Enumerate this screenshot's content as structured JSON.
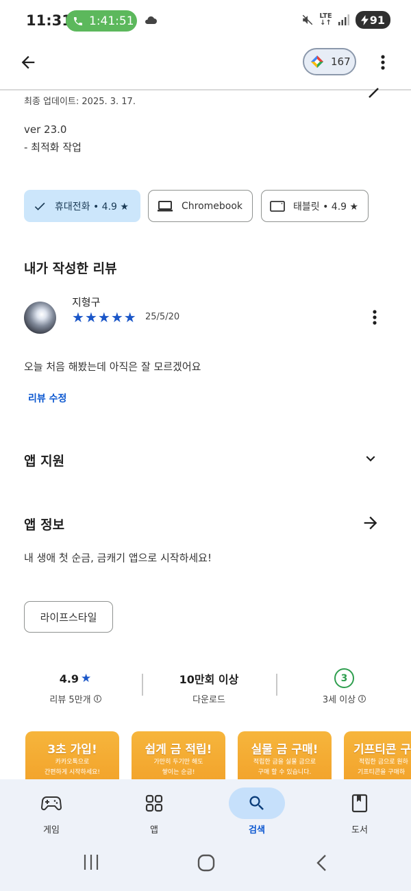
{
  "status_bar": {
    "time": "11:31",
    "call_timer": "1:41:51",
    "network": "LTE",
    "battery": "91"
  },
  "app_bar": {
    "back_icon": "arrow-back-icon",
    "points_value": "167",
    "more_icon": "more-vert-icon"
  },
  "whats_new": {
    "updated": "최종 업데이트: 2025. 3. 17.",
    "version": "ver 23.0",
    "note": "- 최적화 작업"
  },
  "device_chips": [
    {
      "label": "휴대전화 • 4.9",
      "icon": "check-icon",
      "selected": true,
      "has_star": true
    },
    {
      "label": "Chromebook",
      "icon": "laptop-icon",
      "selected": false,
      "has_star": false
    },
    {
      "label": "태블릿 • 4.9",
      "icon": "tablet-icon",
      "selected": false,
      "has_star": true
    }
  ],
  "my_review": {
    "title": "내가 작성한 리뷰",
    "reviewer": "지형구",
    "rating": 5,
    "date": "25/5/20",
    "text": "오늘 처음 해봤는데 아직은 잘 모르겠어요",
    "edit_label": "리뷰 수정"
  },
  "app_support": {
    "title": "앱 지원"
  },
  "app_info": {
    "title": "앱 정보",
    "description": "내 생애 첫 순금, 금캐기 앱으로 시작하세요!",
    "tag": "라이프스타일"
  },
  "stats": {
    "rating": "4.9",
    "reviews": "리뷰 5만개",
    "downloads": "10만회 이상",
    "downloads_label": "다운로드",
    "age": "3",
    "age_label": "3세 이상"
  },
  "screenshots": [
    {
      "title": "3초 가입!",
      "sub1": "카카오톡으로",
      "sub2": "간편하게 시작하세요!"
    },
    {
      "title": "쉽게 금 적립!",
      "sub1": "가만히 두기만 해도",
      "sub2": "쌓이는 순금!"
    },
    {
      "title": "실물 금 구매!",
      "sub1": "적립한 금을 실물 금으로",
      "sub2": "구매 할 수 있습니다."
    },
    {
      "title": "기프티콘 구",
      "sub1": "적립한 금으로 원하",
      "sub2": "기프티콘을 구매하"
    }
  ],
  "bottom_nav": [
    {
      "label": "게임",
      "icon": "gamepad-icon",
      "active": false
    },
    {
      "label": "앱",
      "icon": "apps-grid-icon",
      "active": false
    },
    {
      "label": "검색",
      "icon": "search-icon",
      "active": true
    },
    {
      "label": "도서",
      "icon": "book-icon",
      "active": false
    }
  ],
  "colors": {
    "accent": "#0b57d0",
    "star": "#1a56c8",
    "chip_selected_bg": "#cce6fb",
    "age_badge": "#2e9e4e",
    "card_orange": "#f2a22a",
    "nav_bg": "#eef2f9"
  }
}
